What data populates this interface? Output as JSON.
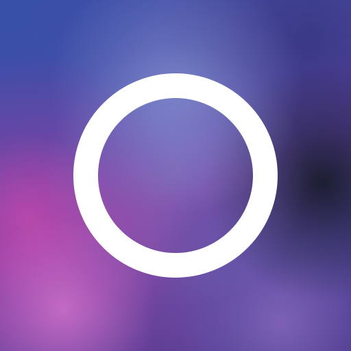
{
  "app_icon": {
    "icon": "circle-ring-icon",
    "ring_color": "#ffffff",
    "background_colors": [
      "#3b4fa3",
      "#6b3a9c",
      "#c04aa8",
      "#1c2230"
    ]
  }
}
